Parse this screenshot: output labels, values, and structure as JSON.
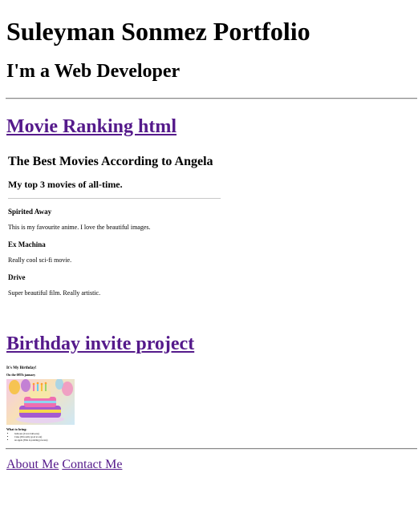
{
  "header": {
    "title": "Suleyman Sonmez Portfolio",
    "subtitle": "I'm a Web Developer"
  },
  "projects": [
    {
      "link_label": "Movie Ranking html",
      "preview": {
        "heading": "The Best Movies According to Angela",
        "subheading": "My top 3 movies of all-time.",
        "movies": [
          {
            "title": "Spirited Away",
            "description": "This is my favourite anime. I love the beautiful images."
          },
          {
            "title": "Ex Machina",
            "description": "Really cool sci-fi movie."
          },
          {
            "title": "Drive",
            "description": "Super beautiful film. Really artistic."
          }
        ]
      }
    },
    {
      "link_label": "Birthday invite project",
      "preview": {
        "title": "It's My Birthday!",
        "subtitle": "On the 08Th january",
        "image": "birthday-cake-image",
        "bring_title": "What to bring:",
        "bring_items": [
          "balloons (I love balloons)",
          "Cake (I'm really good at eat)",
          "an apple (This is pointing process)"
        ]
      }
    }
  ],
  "footer": {
    "links": [
      "About Me",
      "Contact Me"
    ]
  },
  "colors": {
    "link_visited": "#551A8B",
    "rule": "#8a8a8a"
  }
}
